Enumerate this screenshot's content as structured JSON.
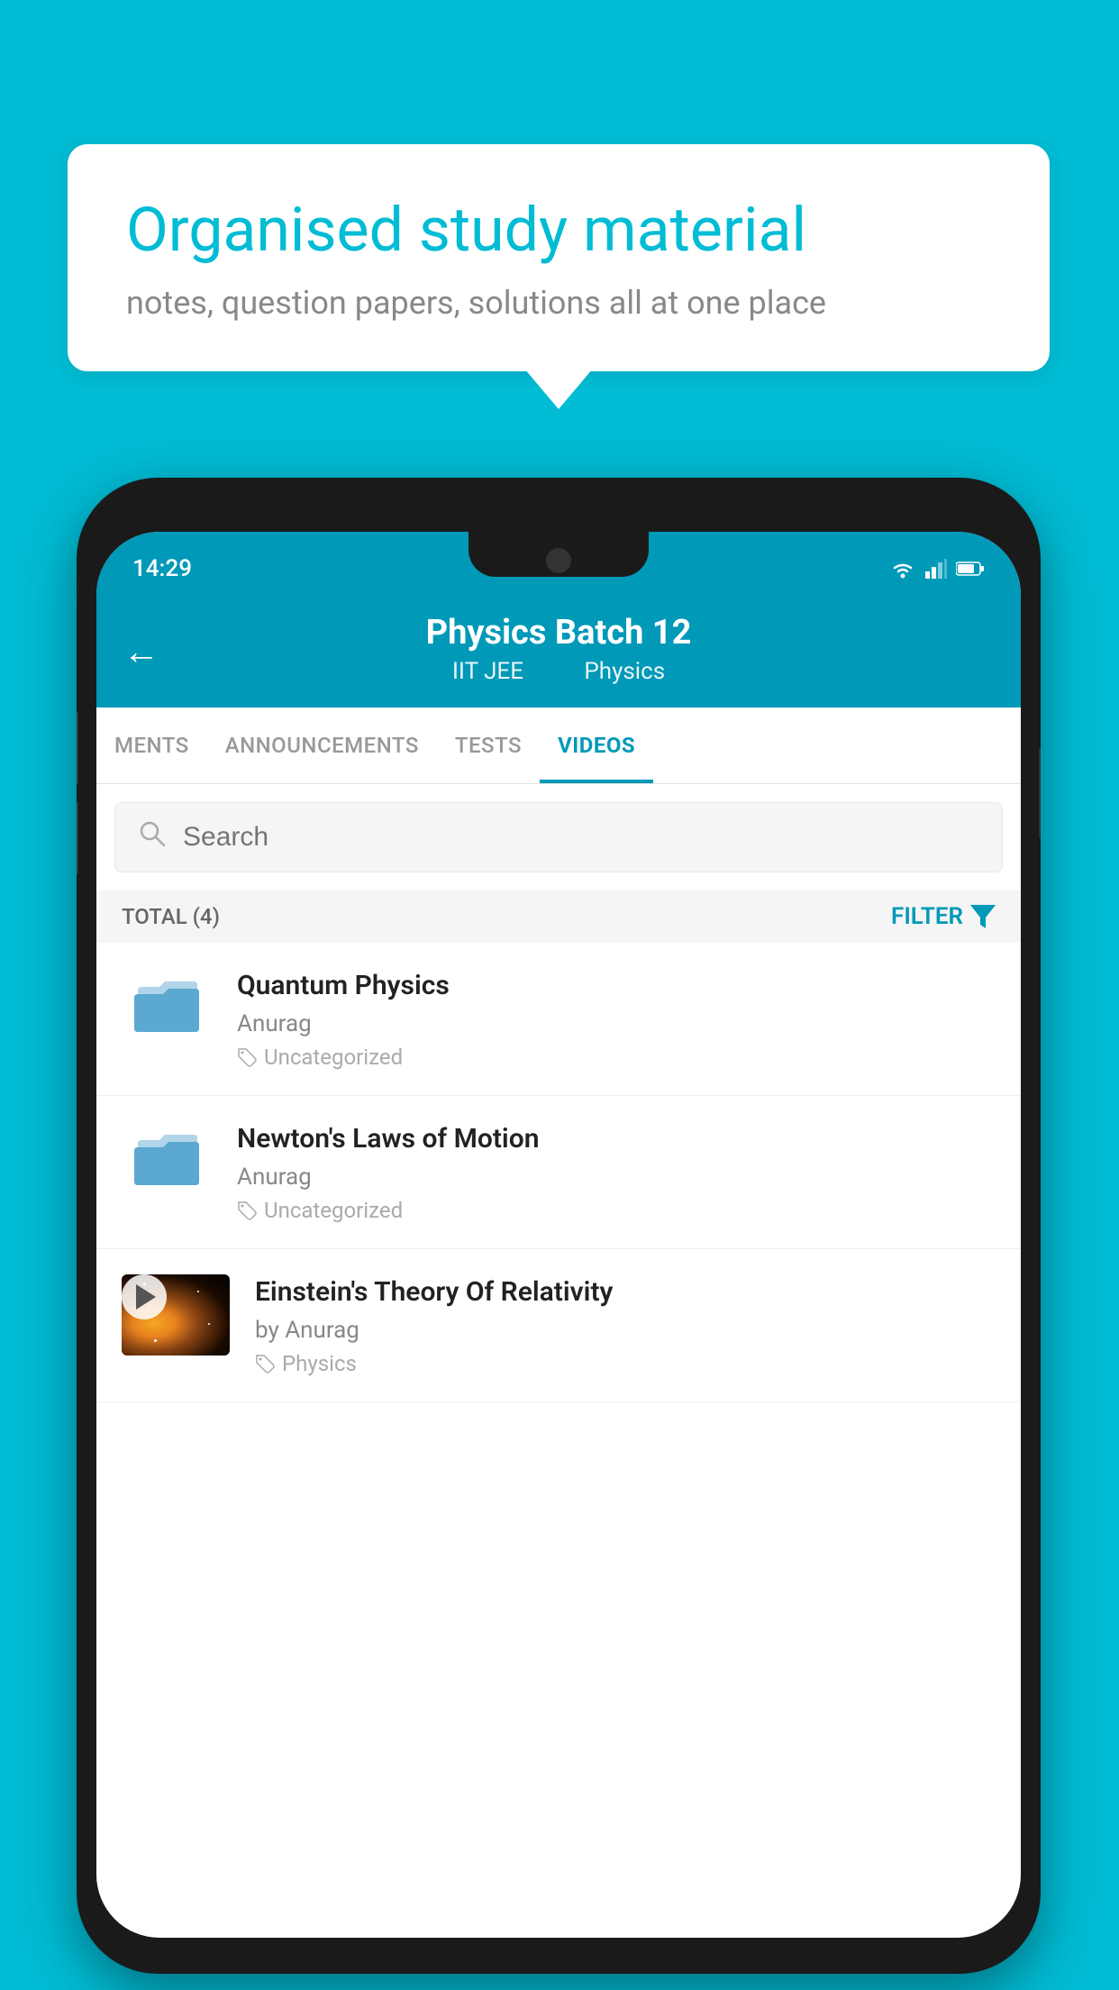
{
  "background_color": "#00BCD4",
  "speech_bubble": {
    "title": "Organised study material",
    "subtitle": "notes, question papers, solutions all at one place"
  },
  "status_bar": {
    "time": "14:29",
    "wifi_icon": "wifi",
    "signal_icon": "signal",
    "battery_icon": "battery"
  },
  "app_header": {
    "back_label": "←",
    "title": "Physics Batch 12",
    "subtitle_part1": "IIT JEE",
    "subtitle_part2": "Physics"
  },
  "tabs": [
    {
      "label": "MENTS",
      "active": false
    },
    {
      "label": "ANNOUNCEMENTS",
      "active": false
    },
    {
      "label": "TESTS",
      "active": false
    },
    {
      "label": "VIDEOS",
      "active": true
    }
  ],
  "search": {
    "placeholder": "Search"
  },
  "filter_bar": {
    "total_label": "TOTAL (4)",
    "filter_label": "FILTER"
  },
  "videos": [
    {
      "id": 1,
      "title": "Quantum Physics",
      "author": "Anurag",
      "tag": "Uncategorized",
      "has_thumbnail": false
    },
    {
      "id": 2,
      "title": "Newton's Laws of Motion",
      "author": "Anurag",
      "tag": "Uncategorized",
      "has_thumbnail": false
    },
    {
      "id": 3,
      "title": "Einstein's Theory Of Relativity",
      "author": "by Anurag",
      "tag": "Physics",
      "has_thumbnail": true
    }
  ]
}
